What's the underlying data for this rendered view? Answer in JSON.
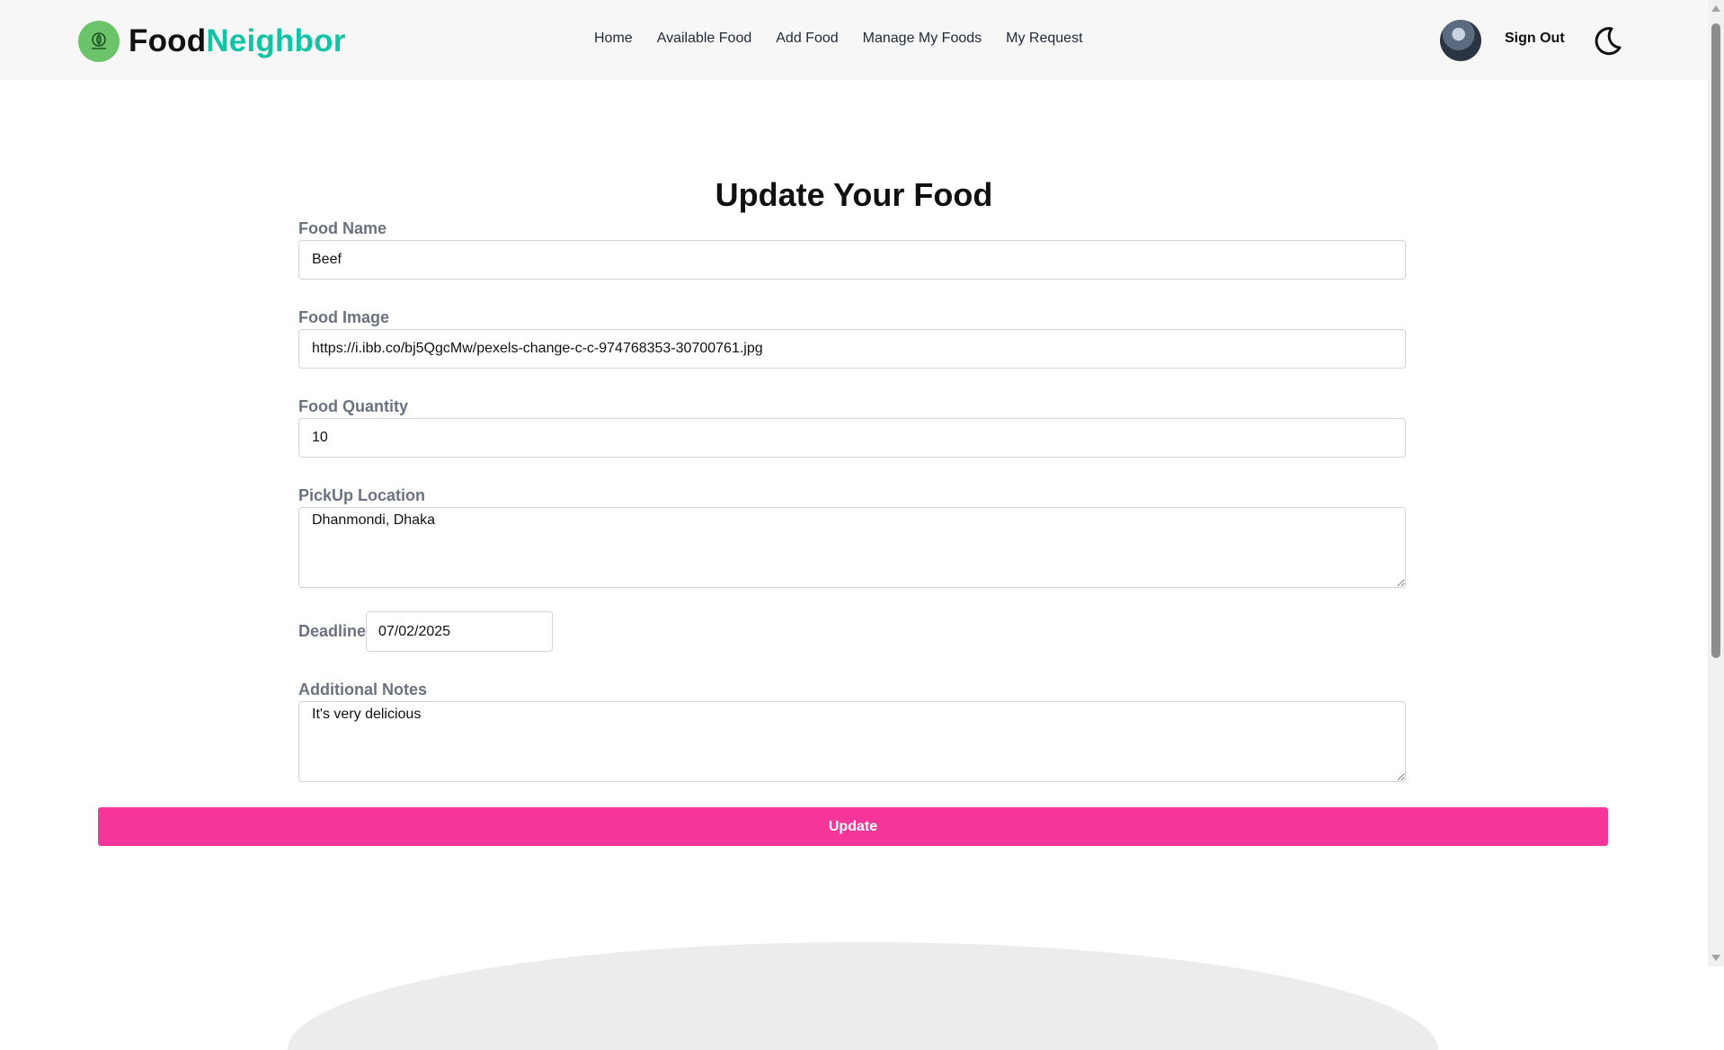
{
  "brand": {
    "food": "Food",
    "neighbor": "Neighbor",
    "icon": "leaf-bowl-icon"
  },
  "nav": {
    "links": [
      {
        "label": "Home"
      },
      {
        "label": "Available Food"
      },
      {
        "label": "Add Food"
      },
      {
        "label": "Manage My Foods"
      },
      {
        "label": "My Request"
      }
    ],
    "sign_out": "Sign Out",
    "theme_icon": "moon-icon"
  },
  "form": {
    "title": "Update Your Food",
    "food_name": {
      "label": "Food Name",
      "value": "Beef"
    },
    "food_image": {
      "label": "Food Image",
      "value": "https://i.ibb.co/bj5QgcMw/pexels-change-c-c-974768353-30700761.jpg"
    },
    "food_quantity": {
      "label": "Food Quantity",
      "value": "10"
    },
    "pickup_location": {
      "label": "PickUp Location",
      "value": "Dhanmondi, Dhaka"
    },
    "deadline": {
      "label": "Deadline",
      "value": "07/02/2025"
    },
    "notes": {
      "label": "Additional Notes",
      "value": "It's very delicious"
    },
    "submit_label": "Update"
  },
  "colors": {
    "accent": "#f5359a",
    "brand_teal": "#14c3a5",
    "logo_green": "#6cc46a"
  }
}
